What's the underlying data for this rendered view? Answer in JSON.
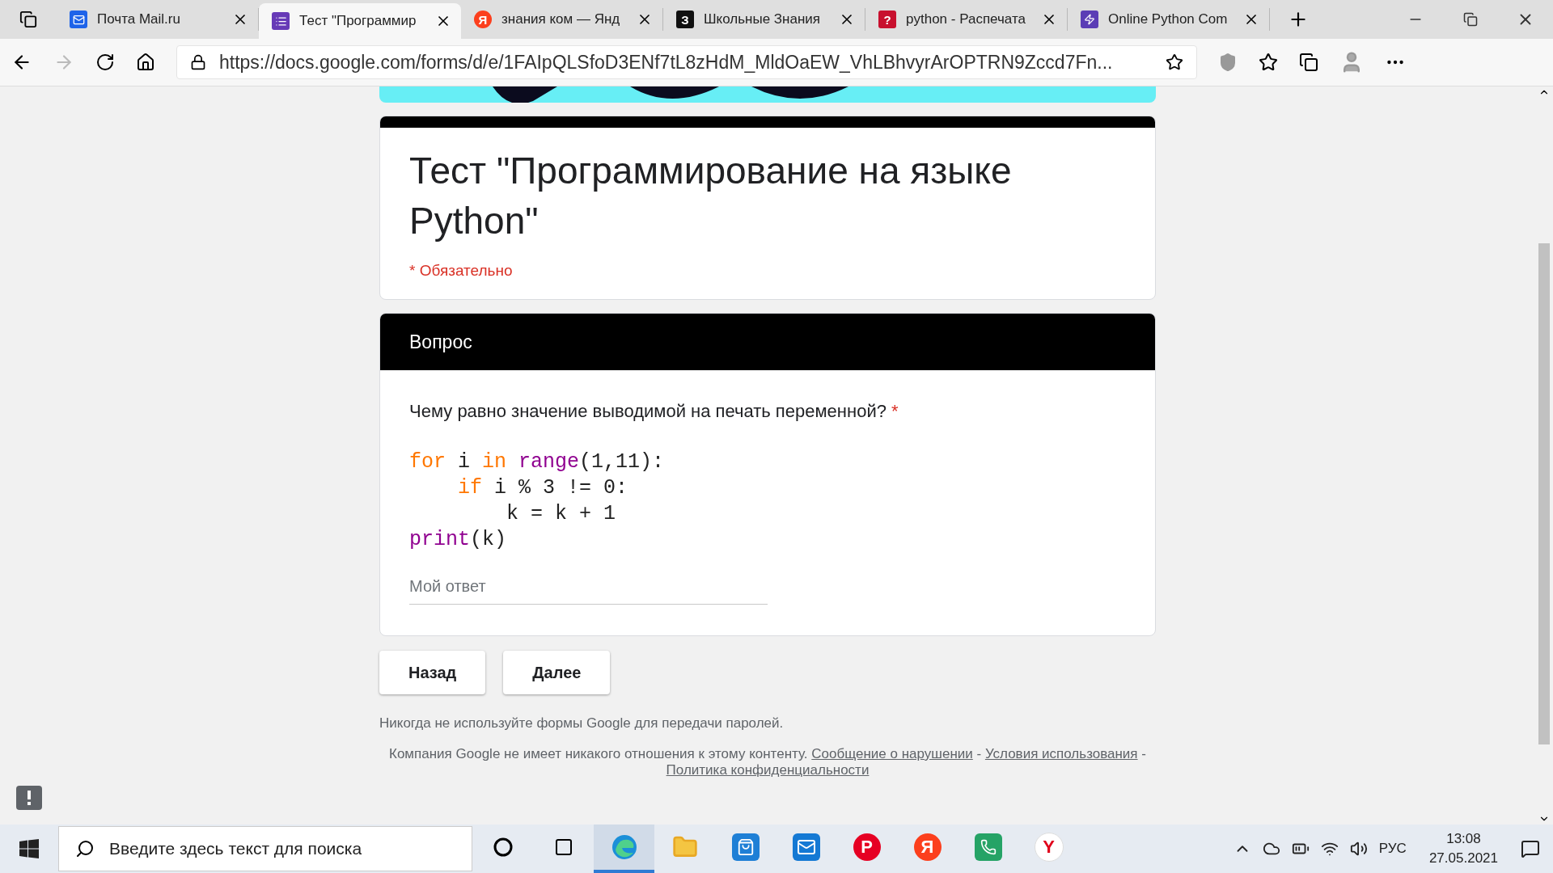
{
  "browser": {
    "tabs": [
      {
        "label": "Почта Mail.ru",
        "selected": false
      },
      {
        "label": "Тест \"Программир",
        "selected": true
      },
      {
        "icon_text": "Я",
        "label": "знания ком — Янд",
        "selected": false
      },
      {
        "icon_text": "З",
        "label": "Школьные Знания",
        "selected": false
      },
      {
        "icon_text": "?",
        "label": "python - Распечата",
        "selected": false
      },
      {
        "label": "Online Python Com",
        "selected": false
      }
    ],
    "url": "https://docs.google.com/forms/d/e/1FAIpQLSfoD3ENf7tL8zHdM_MldOaEW_VhLBhvyrArOPTRN9Zccd7Fn..."
  },
  "form": {
    "title": "Тест \"Программирование на языке Python\"",
    "required_note": "* Обязательно",
    "section": {
      "title": "Вопрос"
    },
    "question": {
      "text": "Чему равно значение выводимой на печать переменной?",
      "required_mark": "*",
      "code": [
        [
          {
            "kind": "keyword",
            "text": "for"
          },
          {
            "kind": "plain",
            "text": " i "
          },
          {
            "kind": "keyword",
            "text": "in"
          },
          {
            "kind": "builtin",
            "text": " range"
          },
          {
            "kind": "plain",
            "text": "(1,11):"
          }
        ],
        [
          {
            "kind": "keyword",
            "text": "    if"
          },
          {
            "kind": "plain",
            "text": " i % 3 != 0:"
          }
        ],
        [
          {
            "kind": "plain",
            "text": "        k = k + 1"
          }
        ],
        [
          {
            "kind": "builtin",
            "text": "print"
          },
          {
            "kind": "plain",
            "text": "(k)"
          }
        ]
      ],
      "answer": {
        "placeholder": "Мой ответ"
      }
    },
    "buttons": [
      "Назад",
      "Далее"
    ],
    "warning": "Никогда не используйте формы Google для передачи паролей.",
    "footer": [
      {
        "kind": "text",
        "text": "Компания Google не имеет никакого отношения к этому контенту. "
      },
      {
        "kind": "link",
        "text": "Сообщение о нарушении"
      },
      {
        "kind": "text",
        "text": " - "
      },
      {
        "kind": "link",
        "text": "Условия использования"
      },
      {
        "kind": "text",
        "text": " - "
      },
      {
        "kind": "link",
        "text": "Политика конфиденциальности"
      }
    ]
  },
  "taskbar": {
    "search_placeholder": "Введите здесь текст для поиска",
    "apps": [
      {
        "selected": true
      },
      {
        "selected": false
      },
      {
        "selected": false
      },
      {
        "selected": false
      },
      {
        "icon_text": "P",
        "selected": false
      },
      {
        "icon_text": "Я",
        "selected": false
      },
      {
        "selected": false
      },
      {
        "icon_text": "Y",
        "selected": false
      }
    ],
    "language": "РУС",
    "time": "13:08",
    "date": "27.05.2021"
  }
}
